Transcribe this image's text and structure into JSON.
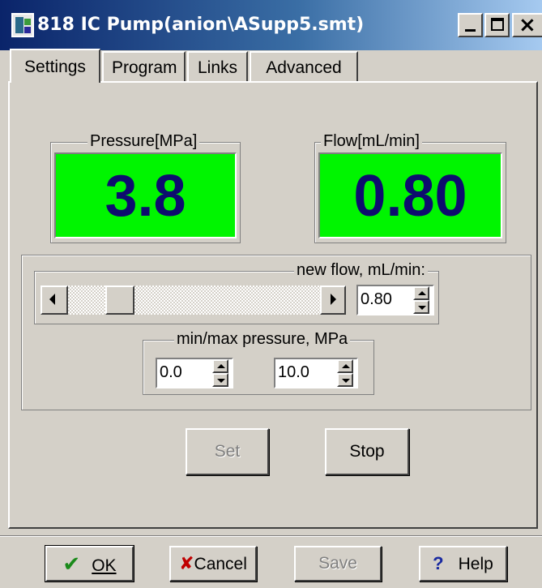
{
  "window": {
    "title": "818 IC Pump(anion\\ASupp5.smt)",
    "controls": {
      "minimize": "minimize-icon",
      "maximize": "maximize-icon",
      "close": "close-icon"
    }
  },
  "tabs": [
    {
      "label": "Settings",
      "active": true
    },
    {
      "label": "Program",
      "active": false
    },
    {
      "label": "Links",
      "active": false
    },
    {
      "label": "Advanced",
      "active": false
    }
  ],
  "pressure": {
    "label": "Pressure[MPa]",
    "value": "3.8"
  },
  "flow": {
    "label": "Flow[mL/min]",
    "value": "0.80"
  },
  "new_flow": {
    "label": "new flow, mL/min:",
    "value": "0.80",
    "slider_fraction": 0.12
  },
  "pressure_limits": {
    "label": "min/max pressure, MPa",
    "min": "0.0",
    "max": "10.0"
  },
  "actions": {
    "set": "Set",
    "stop": "Stop"
  },
  "footer": {
    "ok": "OK",
    "cancel": "Cancel",
    "save": "Save",
    "help": "Help"
  },
  "colors": {
    "display_bg": "#00f500",
    "display_text": "#0d0d6e",
    "titlebar": "#0a246a"
  }
}
